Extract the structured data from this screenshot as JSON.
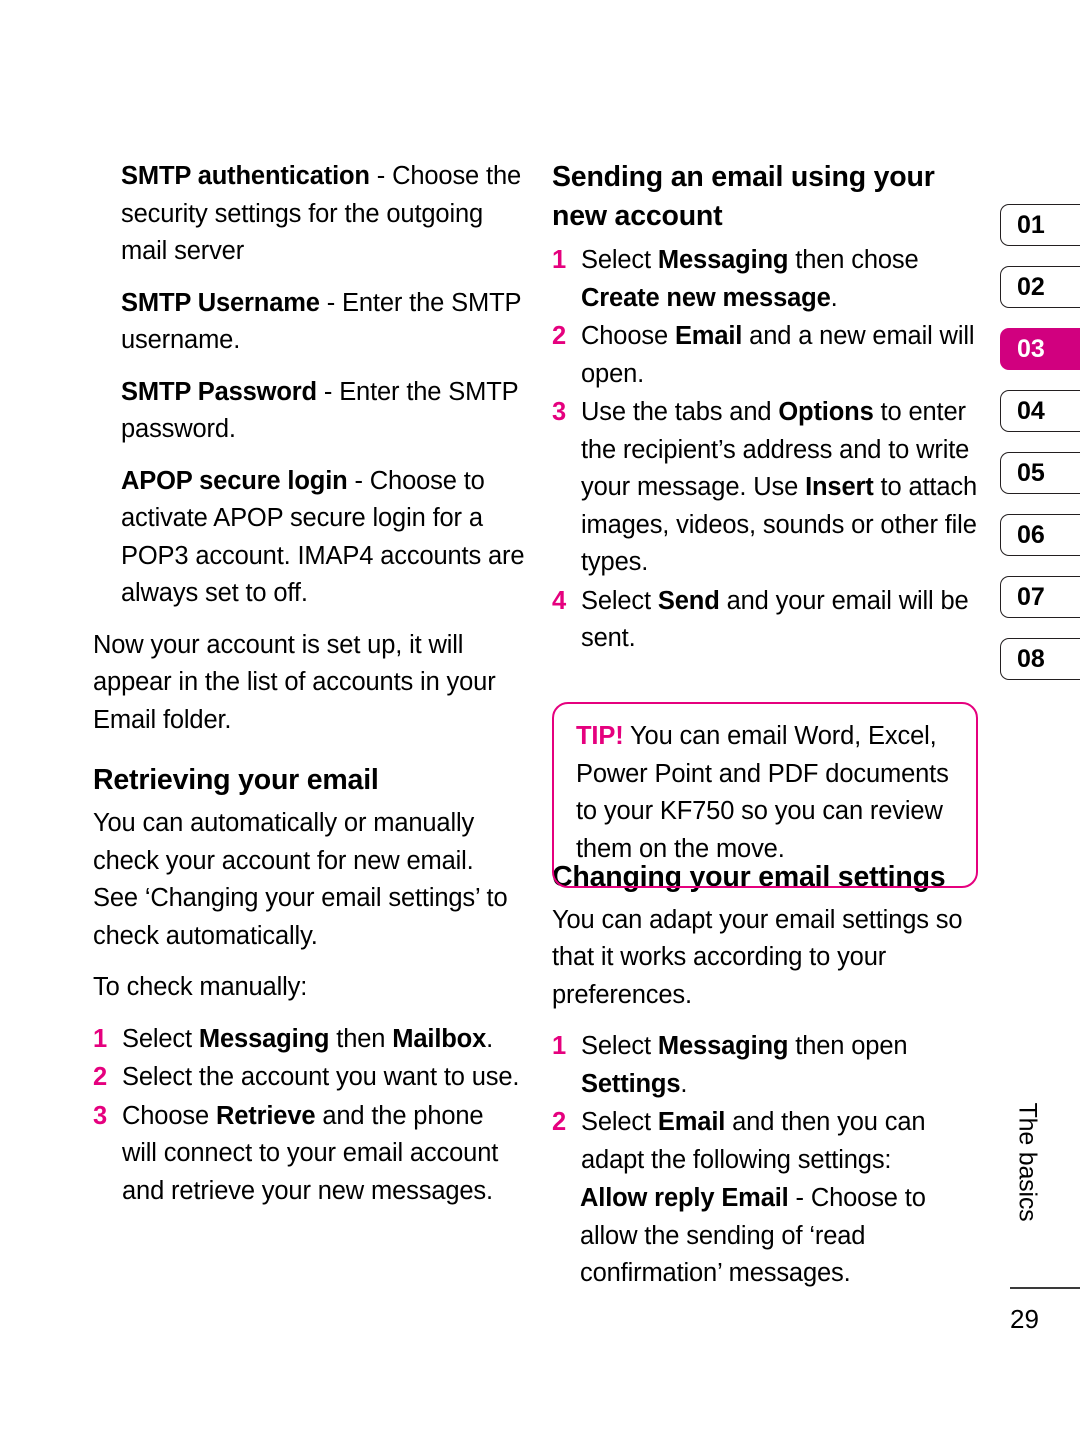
{
  "document": {
    "chapter_label": "The basics",
    "page_number": "29",
    "accent_color": "#e5007e",
    "tab_active_color": "#d1007f"
  },
  "tabs": [
    {
      "label": "01",
      "active": false
    },
    {
      "label": "02",
      "active": false
    },
    {
      "label": "03",
      "active": true
    },
    {
      "label": "04",
      "active": false
    },
    {
      "label": "05",
      "active": false
    },
    {
      "label": "06",
      "active": false
    },
    {
      "label": "07",
      "active": false
    },
    {
      "label": "08",
      "active": false
    }
  ],
  "left_column": {
    "definitions": [
      {
        "term": "SMTP authentication",
        "separator": " - ",
        "description": "Choose the security settings for the outgoing mail server"
      },
      {
        "term": "SMTP Username",
        "separator": " - ",
        "description": "Enter the SMTP username."
      },
      {
        "term": "SMTP Password",
        "separator": " - ",
        "description": "Enter the SMTP password."
      },
      {
        "term": "APOP secure login",
        "separator": " - ",
        "description": "Choose to activate APOP secure login for a POP3 account. IMAP4 accounts are always set to off."
      }
    ],
    "paragraph": "Now your account is set up, it will appear in the list of accounts in your Email folder.",
    "heading": "Retrieving your email",
    "intro": "You can automatically or manually check your account for new email. See ‘Changing your email settings’  to check automatically.",
    "manual_lead": "To check manually:",
    "steps": [
      {
        "num": "1",
        "parts": [
          {
            "text": "Select ",
            "bold": false
          },
          {
            "text": "Messaging",
            "bold": true
          },
          {
            "text": " then ",
            "bold": false
          },
          {
            "text": "Mailbox",
            "bold": true
          },
          {
            "text": ".",
            "bold": false
          }
        ]
      },
      {
        "num": "2",
        "parts": [
          {
            "text": "Select the account you want to use.",
            "bold": false
          }
        ]
      },
      {
        "num": "3",
        "parts": [
          {
            "text": "Choose ",
            "bold": false
          },
          {
            "text": "Retrieve",
            "bold": true
          },
          {
            "text": " and the phone will connect to your email account and retrieve your new messages.",
            "bold": false
          }
        ]
      }
    ]
  },
  "right_column": {
    "heading_send": "Sending an email using your new account",
    "send_steps": [
      {
        "num": "1",
        "parts": [
          {
            "text": "Select ",
            "bold": false
          },
          {
            "text": "Messaging",
            "bold": true
          },
          {
            "text": " then chose ",
            "bold": false
          },
          {
            "text": "Create new message",
            "bold": true
          },
          {
            "text": ".",
            "bold": false
          }
        ]
      },
      {
        "num": "2",
        "parts": [
          {
            "text": "Choose ",
            "bold": false
          },
          {
            "text": "Email",
            "bold": true
          },
          {
            "text": " and a new email will open.",
            "bold": false
          }
        ]
      },
      {
        "num": "3",
        "parts": [
          {
            "text": "Use the tabs and ",
            "bold": false
          },
          {
            "text": "Options",
            "bold": true
          },
          {
            "text": " to enter the recipient’s address and to write your message. Use ",
            "bold": false
          },
          {
            "text": "Insert",
            "bold": true
          },
          {
            "text": " to attach images, videos, sounds or other file types.",
            "bold": false
          }
        ]
      },
      {
        "num": "4",
        "parts": [
          {
            "text": "Select ",
            "bold": false
          },
          {
            "text": "Send",
            "bold": true
          },
          {
            "text": " and your email will be sent.",
            "bold": false
          }
        ]
      }
    ],
    "tip": {
      "label": "TIP!",
      "text": " You can email Word, Excel, Power Point and PDF documents to your KF750 so you can review them on the move."
    },
    "heading_settings": "Changing your email settings",
    "settings_intro": "You can adapt your email settings so that it works according to your preferences.",
    "settings_steps": [
      {
        "num": "1",
        "parts": [
          {
            "text": "Select ",
            "bold": false
          },
          {
            "text": "Messaging",
            "bold": true
          },
          {
            "text": " then open ",
            "bold": false
          },
          {
            "text": "Settings",
            "bold": true
          },
          {
            "text": ".",
            "bold": false
          }
        ]
      },
      {
        "num": "2",
        "parts": [
          {
            "text": "Select ",
            "bold": false
          },
          {
            "text": "Email",
            "bold": true
          },
          {
            "text": " and then you can adapt the following settings:",
            "bold": false
          }
        ]
      }
    ],
    "settings_definition": {
      "term": "Allow reply Email",
      "separator": " - ",
      "description": "Choose to allow the sending of ‘read confirmation’ messages."
    }
  }
}
